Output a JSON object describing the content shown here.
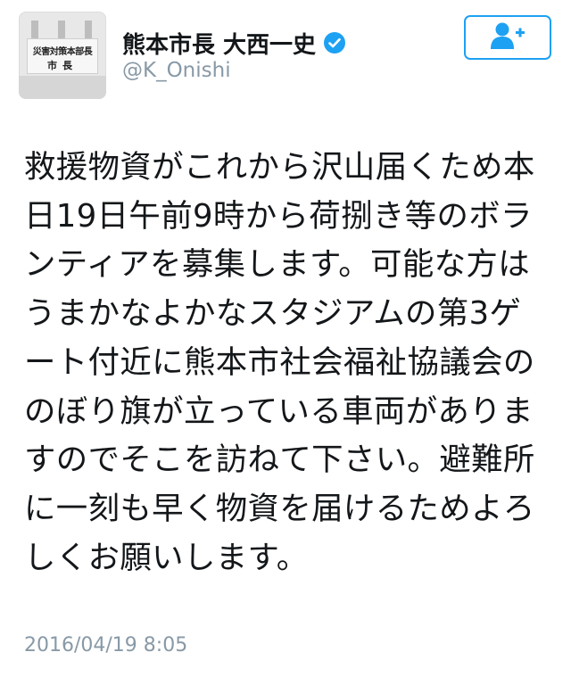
{
  "profile": {
    "avatar_sign_line1": "災害対策本部長",
    "avatar_sign_line2": "市長",
    "display_name": "熊本市長 大西一史",
    "handle": "@K_Onishi",
    "verified_icon": "verified-badge-icon",
    "follow_icon": "add-user-icon"
  },
  "tweet": {
    "text": "救援物資がこれから沢山届くため本日19日午前9時から荷捌き等のボランティアを募集します。可能な方はうまかなよかなスタジアムの第3ゲート付近に熊本市社会福祉協議会ののぼり旗が立っている車両がありますのでそこを訪ねて下さい。避難所に一刻も早く物資を届けるためよろしくお願いします。",
    "timestamp": "2016/04/19 8:05"
  },
  "colors": {
    "accent": "#1da1f2",
    "text": "#14171a",
    "secondary_text": "#8899a6"
  }
}
